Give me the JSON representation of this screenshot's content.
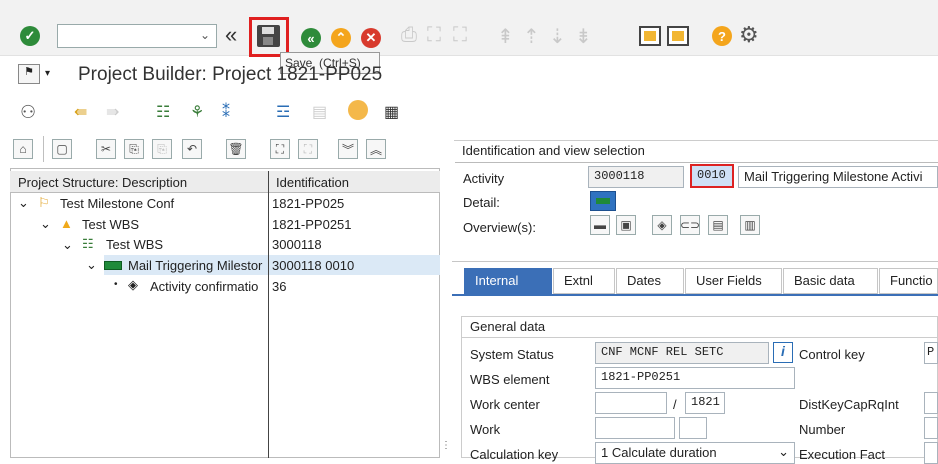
{
  "toolbar": {
    "tooltip_label": "Save",
    "tooltip_shortcut": "(Ctrl+S)"
  },
  "title": "Project Builder: Project 1821-PP025",
  "tree": {
    "col_desc": "Project Structure: Description",
    "col_id": "Identification",
    "rows": [
      {
        "desc": "Test Milestone Conf",
        "id": "1821-PP025"
      },
      {
        "desc": "Test WBS",
        "id": "1821-PP0251"
      },
      {
        "desc": "Test WBS",
        "id": "3000118"
      },
      {
        "desc": "Mail Triggering Milestor",
        "id": "3000118 0010"
      },
      {
        "desc": "Activity confirmatio",
        "id": "36"
      }
    ]
  },
  "detail": {
    "section_title": "Identification and view selection",
    "activity_label": "Activity",
    "activity_value": "3000118",
    "activity_op": "0010",
    "activity_desc": "Mail Triggering Milestone Activi",
    "detail_label": "Detail:",
    "overview_label": "Overview(s):",
    "tabs": [
      "Internal",
      "Extnl",
      "Dates",
      "User Fields",
      "Basic data",
      "Functio"
    ],
    "general_title": "General data",
    "system_status_label": "System Status",
    "system_status_value": "CNF  MCNF REL  SETC",
    "control_key_label": "Control key",
    "control_key_value": "P",
    "wbs_label": "WBS element",
    "wbs_value": "1821-PP0251",
    "workcenter_label": "Work center",
    "workcenter_slash": "/",
    "workcenter_plant": "1821",
    "distkey_label": "DistKeyCapRqInt",
    "work_label": "Work",
    "number_label": "Number",
    "calckey_label": "Calculation key",
    "calckey_value": "1 Calculate duration",
    "execfact_label": "Execution Fact"
  }
}
